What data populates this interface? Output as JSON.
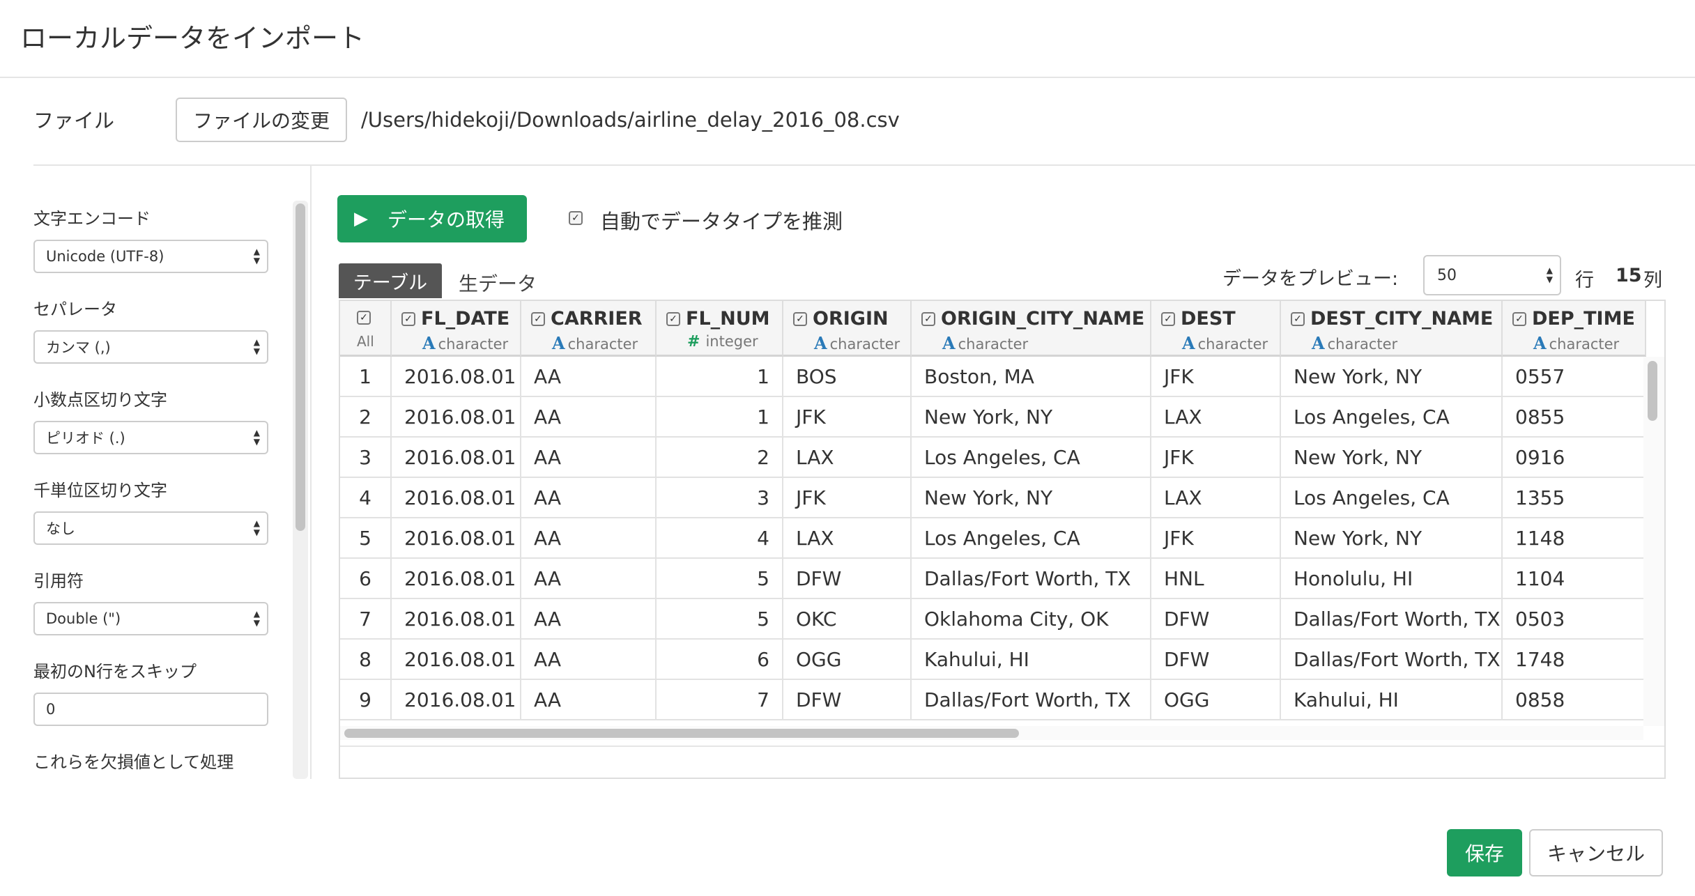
{
  "dialog": {
    "title": "ローカルデータをインポート"
  },
  "file": {
    "label": "ファイル",
    "change_button": "ファイルの変更",
    "path": "/Users/hidekoji/Downloads/airline_delay_2016_08.csv"
  },
  "sidebar": {
    "encoding": {
      "label": "文字エンコード",
      "value": "Unicode (UTF-8)"
    },
    "separator": {
      "label": "セパレータ",
      "value": "カンマ (,)"
    },
    "decimal": {
      "label": "小数点区切り文字",
      "value": "ピリオド (.)"
    },
    "thousands": {
      "label": "千単位区切り文字",
      "value": "なし"
    },
    "quote": {
      "label": "引用符",
      "value": "Double (\")"
    },
    "skip": {
      "label": "最初のN行をスキップ",
      "value": "0"
    },
    "na": {
      "label": "これらを欠損値として処理"
    }
  },
  "toolbar": {
    "get_data_button": "データの取得",
    "auto_detect_label": "自動でデータタイプを推測",
    "auto_detect_checked": true
  },
  "tabs": {
    "table": "テーブル",
    "raw": "生データ"
  },
  "preview": {
    "label": "データをプレビュー:",
    "rows_value": "50",
    "rows_unit": "行",
    "cols_count": "15",
    "cols_unit": "列"
  },
  "grid": {
    "all_label": "All",
    "columns": [
      {
        "name": "FL_DATE",
        "type": "character"
      },
      {
        "name": "CARRIER",
        "type": "character"
      },
      {
        "name": "FL_NUM",
        "type": "integer"
      },
      {
        "name": "ORIGIN",
        "type": "character"
      },
      {
        "name": "ORIGIN_CITY_NAME",
        "type": "character"
      },
      {
        "name": "DEST",
        "type": "character"
      },
      {
        "name": "DEST_CITY_NAME",
        "type": "character"
      },
      {
        "name": "DEP_TIME",
        "type": "character"
      }
    ],
    "rows": [
      [
        "1",
        "2016.08.01",
        "AA",
        "1",
        "BOS",
        "Boston, MA",
        "JFK",
        "New York, NY",
        "0557"
      ],
      [
        "2",
        "2016.08.01",
        "AA",
        "1",
        "JFK",
        "New York, NY",
        "LAX",
        "Los Angeles, CA",
        "0855"
      ],
      [
        "3",
        "2016.08.01",
        "AA",
        "2",
        "LAX",
        "Los Angeles, CA",
        "JFK",
        "New York, NY",
        "0916"
      ],
      [
        "4",
        "2016.08.01",
        "AA",
        "3",
        "JFK",
        "New York, NY",
        "LAX",
        "Los Angeles, CA",
        "1355"
      ],
      [
        "5",
        "2016.08.01",
        "AA",
        "4",
        "LAX",
        "Los Angeles, CA",
        "JFK",
        "New York, NY",
        "1148"
      ],
      [
        "6",
        "2016.08.01",
        "AA",
        "5",
        "DFW",
        "Dallas/Fort Worth, TX",
        "HNL",
        "Honolulu, HI",
        "1104"
      ],
      [
        "7",
        "2016.08.01",
        "AA",
        "5",
        "OKC",
        "Oklahoma City, OK",
        "DFW",
        "Dallas/Fort Worth, TX",
        "0503"
      ],
      [
        "8",
        "2016.08.01",
        "AA",
        "6",
        "OGG",
        "Kahului, HI",
        "DFW",
        "Dallas/Fort Worth, TX",
        "1748"
      ],
      [
        "9",
        "2016.08.01",
        "AA",
        "7",
        "DFW",
        "Dallas/Fort Worth, TX",
        "OGG",
        "Kahului, HI",
        "0858"
      ]
    ]
  },
  "footer": {
    "save_button": "保存",
    "cancel_button": "キャンセル"
  },
  "colors": {
    "accent": "#1e9e5e",
    "type_char": "#2a7ab8",
    "type_int": "#1e9e5e"
  }
}
